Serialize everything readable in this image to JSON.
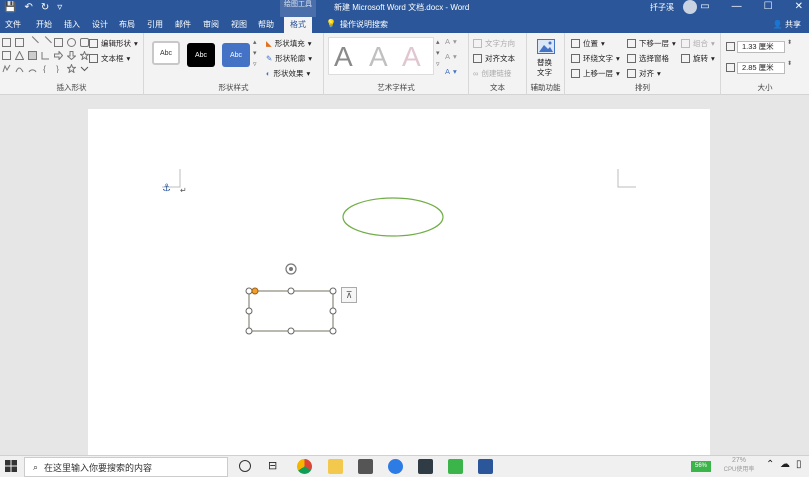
{
  "titlebar": {
    "qat": [
      "💾",
      "↶",
      "↻",
      "▿"
    ],
    "context_tab_label": "绘图工具",
    "doc_title": "新建 Microsoft Word 文档.docx - Word",
    "user_name": "扦子溪",
    "window_buttons": [
      "▭",
      "—",
      "☐",
      "✕"
    ]
  },
  "tabs": [
    {
      "label": "文件"
    },
    {
      "label": "开始"
    },
    {
      "label": "插入"
    },
    {
      "label": "设计"
    },
    {
      "label": "布局"
    },
    {
      "label": "引用"
    },
    {
      "label": "邮件"
    },
    {
      "label": "审阅"
    },
    {
      "label": "视图"
    },
    {
      "label": "帮助"
    },
    {
      "label": "格式",
      "active": true
    }
  ],
  "tellme": {
    "icon": "💡",
    "label": "操作说明搜索"
  },
  "share": "共享",
  "ribbon": {
    "insert_shapes": {
      "label": "插入形状",
      "edit_shape": "编辑形状",
      "text_box": "文本框"
    },
    "shape_styles": {
      "label": "形状样式",
      "boxes": [
        "Abc",
        "Abc",
        "Abc"
      ],
      "fill": "形状填充",
      "outline": "形状轮廓",
      "effects": "形状效果"
    },
    "wordart": {
      "label": "艺术字样式",
      "letters": [
        "A",
        "A",
        "A"
      ],
      "small_letters": [
        "A",
        "A",
        "A"
      ]
    },
    "text": {
      "label": "文本",
      "direction": "文字方向",
      "align": "对齐文本",
      "link": "创建链接"
    },
    "accessibility": {
      "label": "辅助功能",
      "alt_text_line1": "替换",
      "alt_text_line2": "文字"
    },
    "arrange": {
      "label": "排列",
      "position": "位置",
      "wrap_text": "环绕文字",
      "bring_forward": "上移一层",
      "send_backward": "下移一层",
      "selection_pane": "选择窗格",
      "align": "对齐",
      "group": "组合",
      "rotate": "旋转"
    },
    "size": {
      "label": "大小",
      "height": "1.33 厘米",
      "width": "2.85 厘米"
    }
  },
  "document": {
    "anchor_icon": "⚓",
    "return_mark": "↵",
    "layout_options_icon": "⊼"
  },
  "taskbar": {
    "search_placeholder": "在这里输入你要搜索的内容",
    "battery_label": "56%",
    "clock_top": "27%",
    "clock_bottom": "CPU使用率"
  },
  "colors": {
    "ribbon_blue": "#2b579a",
    "ellipse_outline": "#70ad47",
    "shape_outline": "#8a8a7a",
    "handle_yellow": "#f0a030",
    "style_blue": "#4472c4"
  }
}
